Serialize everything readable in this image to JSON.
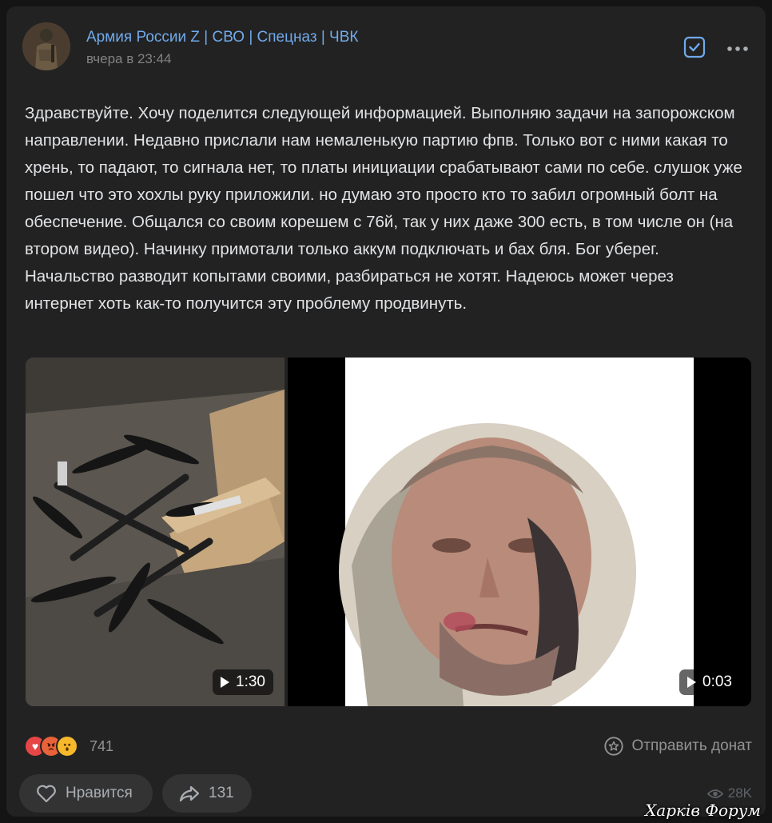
{
  "post": {
    "author": "Армия России Z | СВО | Спецназ | ЧВК",
    "time": "вчера в 23:44",
    "text": "Здравствуйте. Хочу поделится следующей информацией. Выполняю задачи на запорожском направлении. Недавно прислали нам немаленькую партию фпв. Только вот с ними какая то хрень, то падают, то сигнала нет, то платы инициации срабатывают сами по себе. слушок уже пошел что это хохлы руку приложили. но думаю это просто кто то забил огромный болт на обеспечение. Общался со своим корешем с 76й, так у них даже 300 есть, в том числе он (на втором видео). Начинку примотали только аккум подключать и бах бля. Бог уберег.\nНачальство разводит копытами своими, разбираться не хотят. Надеюсь может через интернет хоть как-то получится эту проблему продвинуть."
  },
  "videos": [
    {
      "duration": "1:30"
    },
    {
      "duration": "0:03"
    }
  ],
  "reactions": {
    "icons": [
      "heart-icon",
      "angry-icon",
      "wow-icon"
    ],
    "count": "741"
  },
  "donate": {
    "label": "Отправить донат"
  },
  "actions": {
    "like_label": "Нравится",
    "share_count": "131"
  },
  "views": "28K",
  "watermark": "Харків Форум",
  "colors": {
    "background": "#141414",
    "card": "#222222",
    "link": "#71aaeb",
    "muted": "#828282",
    "accent_checkbox": "#71aaeb"
  }
}
